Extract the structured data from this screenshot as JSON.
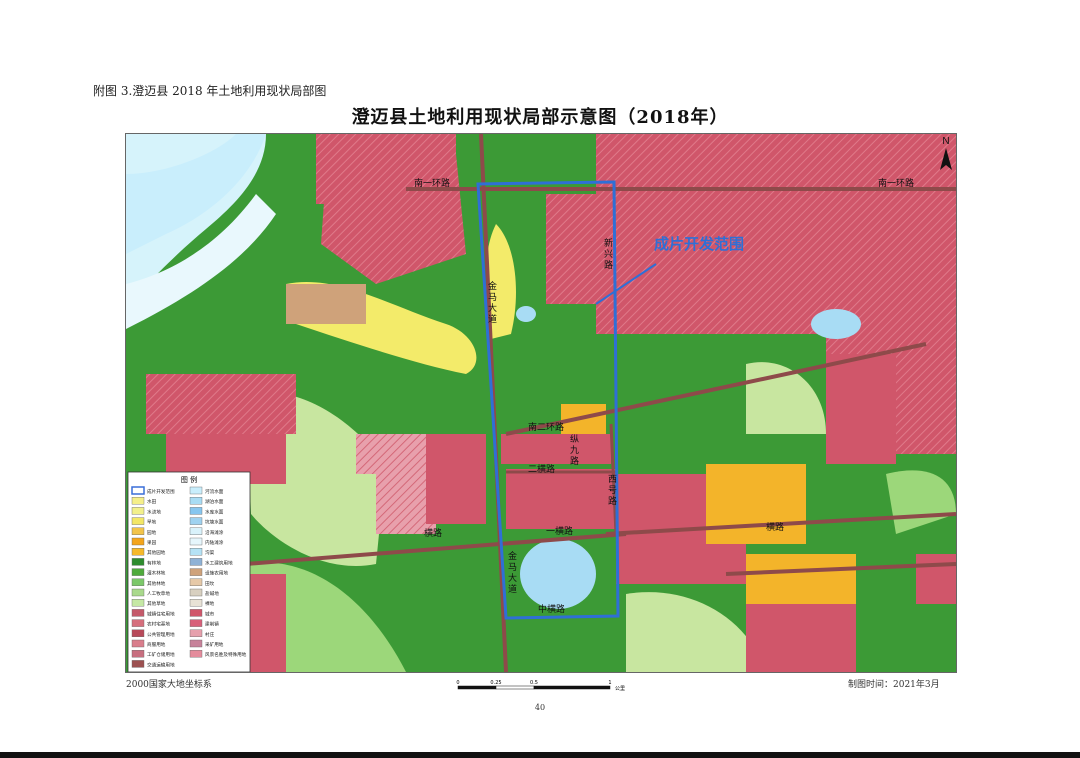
{
  "caption": "附图 3.澄迈县 2018 年土地利用现状局部图",
  "title": "澄迈县土地利用现状局部示意图（2018年）",
  "north_label": "N",
  "annotation": "成片开发范围",
  "roads": {
    "nanyihuan_left": "南一环路",
    "nanyihuan_right": "南一环路",
    "xinxing": [
      "新",
      "兴",
      "路"
    ],
    "jinma_upper": [
      "金",
      "马",
      "大",
      "道"
    ],
    "nanerhuan": "南二环路",
    "zongjiu": [
      "纵",
      "九",
      "路"
    ],
    "erheng": "二横路",
    "xihao": [
      "西",
      "号",
      "路"
    ],
    "heng_left": "横路",
    "yiheng": "一横路",
    "heng_right": "横路",
    "jinma_lower": [
      "金",
      "马",
      "大",
      "道"
    ],
    "zhongheng": "中横路"
  },
  "legend": {
    "title": "图 例",
    "items": [
      {
        "label": "成片开发范围",
        "color": "#3a6fd8"
      },
      {
        "label": "水田",
        "color": "#f5ef8a"
      },
      {
        "label": "水浇地",
        "color": "#f2f08c"
      },
      {
        "label": "旱地",
        "color": "#f3e766"
      },
      {
        "label": "园地",
        "color": "#f2c44a"
      },
      {
        "label": "果园",
        "color": "#f3a51c"
      },
      {
        "label": "其他园地",
        "color": "#f6b92a"
      },
      {
        "label": "有林地",
        "color": "#2e8b2e"
      },
      {
        "label": "灌木林地",
        "color": "#4faa3c"
      },
      {
        "label": "其他林地",
        "color": "#7cc86a"
      },
      {
        "label": "人工牧草地",
        "color": "#a9d98c"
      },
      {
        "label": "其他草地",
        "color": "#c5e8a5"
      },
      {
        "label": "城镇住宅用地",
        "color": "#c45a6a"
      },
      {
        "label": "农村宅基地",
        "color": "#d66f7d"
      },
      {
        "label": "公共管理用地",
        "color": "#b84a5a"
      },
      {
        "label": "商服用地",
        "color": "#d97e8c"
      },
      {
        "label": "工矿仓储用地",
        "color": "#c76f7f"
      },
      {
        "label": "交通运输用地",
        "color": "#9c5050"
      },
      {
        "label": "河流水面",
        "color": "#c9eefc"
      },
      {
        "label": "湖泊水面",
        "color": "#a8dcf4"
      },
      {
        "label": "水库水面",
        "color": "#87c6ef"
      },
      {
        "label": "坑塘水面",
        "color": "#9fd2f0"
      },
      {
        "label": "沿海滩涂",
        "color": "#d9f2fb"
      },
      {
        "label": "内陆滩涂",
        "color": "#e6f6fc"
      },
      {
        "label": "沟渠",
        "color": "#b5e2f5"
      },
      {
        "label": "水工建筑用地",
        "color": "#8fb2d6"
      },
      {
        "label": "设施农用地",
        "color": "#cfa27a"
      },
      {
        "label": "田坎",
        "color": "#e6c9a8"
      },
      {
        "label": "盐碱地",
        "color": "#d8d0c0"
      },
      {
        "label": "裸地",
        "color": "#e8e2d6"
      },
      {
        "label": "城市",
        "color": "#d0566a"
      },
      {
        "label": "建制镇",
        "color": "#d8607a"
      },
      {
        "label": "村庄",
        "color": "#e6a0ac"
      },
      {
        "label": "采矿用地",
        "color": "#c7829a"
      },
      {
        "label": "风景名胜及特殊用地",
        "color": "#e48c9c"
      }
    ]
  },
  "scale": {
    "ticks": [
      "0",
      "0.25",
      "0.5",
      "1"
    ],
    "unit": "公里"
  },
  "footer_left": "2000国家大地坐标系",
  "footer_right": "制图时间：2021年3月",
  "page_number": "40",
  "colors": {
    "urban": "#d0566a",
    "forest": "#2e8b2e",
    "shrub": "#4faa3c",
    "grass": "#9cd77a",
    "light_green": "#c8e6a0",
    "yellow": "#f3eb6a",
    "orange": "#f3b42a",
    "water": "#a8dcf4",
    "river": "#d6f3fb",
    "tan": "#cfa27a",
    "road": "#8e4a4a",
    "boundary": "#2f6fd6",
    "annotation_text": "#2f6fd6"
  }
}
